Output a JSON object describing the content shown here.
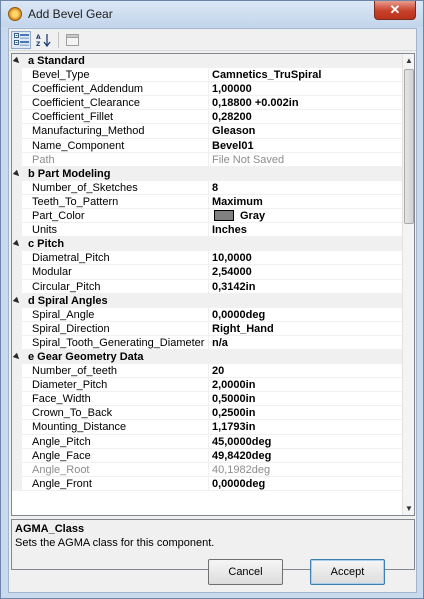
{
  "window": {
    "title": "Add Bevel Gear",
    "close_label": "✕"
  },
  "toolbar": {
    "icons": [
      "categorized-icon",
      "alphabetical-sort-icon",
      "property-pages-icon"
    ]
  },
  "grid": {
    "rows": [
      {
        "type": "category",
        "label": "a Standard"
      },
      {
        "type": "prop",
        "name": "Bevel_Type",
        "value": "Camnetics_TruSpiral"
      },
      {
        "type": "prop",
        "name": "Coefficient_Addendum",
        "value": "1,00000"
      },
      {
        "type": "prop",
        "name": "Coefficient_Clearance",
        "value": "0,18800 +0.002in"
      },
      {
        "type": "prop",
        "name": "Coefficient_Fillet",
        "value": "0,28200"
      },
      {
        "type": "prop",
        "name": "Manufacturing_Method",
        "value": "Gleason"
      },
      {
        "type": "prop",
        "name": "Name_Component",
        "value": "Bevel01"
      },
      {
        "type": "prop",
        "name": "Path",
        "value": "File Not Saved",
        "disabled": true
      },
      {
        "type": "category",
        "label": "b Part Modeling"
      },
      {
        "type": "prop",
        "name": "Number_of_Sketches",
        "value": "8"
      },
      {
        "type": "prop",
        "name": "Teeth_To_Pattern",
        "value": "Maximum"
      },
      {
        "type": "prop",
        "name": "Part_Color",
        "value": "Gray",
        "swatch": "#808080"
      },
      {
        "type": "prop",
        "name": "Units",
        "value": "Inches"
      },
      {
        "type": "category",
        "label": "c Pitch"
      },
      {
        "type": "prop",
        "name": "Diametral_Pitch",
        "value": "10,0000"
      },
      {
        "type": "prop",
        "name": "Modular",
        "value": "2,54000"
      },
      {
        "type": "prop",
        "name": "Circular_Pitch",
        "value": "0,3142in"
      },
      {
        "type": "category",
        "label": "d Spiral Angles"
      },
      {
        "type": "prop",
        "name": "Spiral_Angle",
        "value": "0,0000deg"
      },
      {
        "type": "prop",
        "name": "Spiral_Direction",
        "value": "Right_Hand"
      },
      {
        "type": "prop",
        "name": "Spiral_Tooth_Generating_Diameter",
        "value": "n/a"
      },
      {
        "type": "category",
        "label": "e Gear Geometry Data"
      },
      {
        "type": "prop",
        "name": "Number_of_teeth",
        "value": "20"
      },
      {
        "type": "prop",
        "name": "Diameter_Pitch",
        "value": "2,0000in"
      },
      {
        "type": "prop",
        "name": "Face_Width",
        "value": "0,5000in"
      },
      {
        "type": "prop",
        "name": "Crown_To_Back",
        "value": "0,2500in"
      },
      {
        "type": "prop",
        "name": "Mounting_Distance",
        "value": "1,1793in"
      },
      {
        "type": "prop",
        "name": "Angle_Pitch",
        "value": "45,0000deg"
      },
      {
        "type": "prop",
        "name": "Angle_Face",
        "value": "49,8420deg"
      },
      {
        "type": "prop",
        "name": "Angle_Root",
        "value": "40,1982deg",
        "disabled": true
      },
      {
        "type": "prop",
        "name": "Angle_Front",
        "value": "0,0000deg"
      }
    ]
  },
  "description": {
    "title": "AGMA_Class",
    "text": "Sets the AGMA class for this component."
  },
  "buttons": {
    "cancel": "Cancel",
    "accept": "Accept"
  }
}
